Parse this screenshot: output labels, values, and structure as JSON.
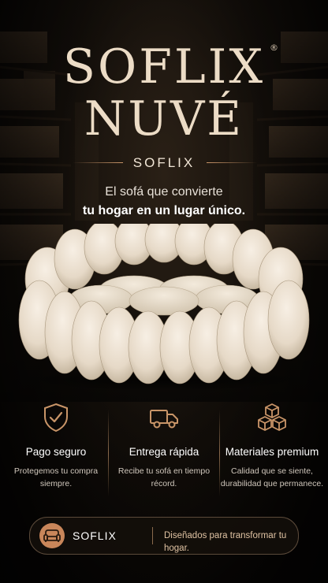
{
  "title": {
    "line1": "SOFLIX",
    "line2": "NUVÉ",
    "registered_mark": "®"
  },
  "brand": "SOFLIX",
  "tagline": {
    "line1": "El sofá que convierte",
    "line2": "tu hogar en un lugar único."
  },
  "features": [
    {
      "icon": "shield-check-icon",
      "title": "Pago seguro",
      "line1": "Protegemos tu compra",
      "line2": "siempre."
    },
    {
      "icon": "truck-icon",
      "title": "Entrega rápida",
      "line1": "Recibe tu sofá en tiempo",
      "line2": "récord."
    },
    {
      "icon": "boxes-icon",
      "title": "Materiales premium",
      "line1": "Calidad que se siente,",
      "line2": "durabilidad que permanece."
    }
  ],
  "footer": {
    "logo_icon": "sofa-logo-icon",
    "brand": "SOFLIX",
    "slogan": "Diseñados para transformar tu hogar."
  },
  "colors": {
    "accent": "#c99568",
    "title": "#ecdcc6",
    "background": "#0b0907"
  }
}
